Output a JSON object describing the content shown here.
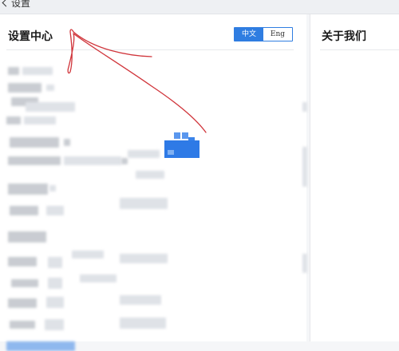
{
  "header": {
    "back_label": "设置"
  },
  "main": {
    "title": "设置中心"
  },
  "language": {
    "options": [
      "中文",
      "Eng"
    ],
    "selected": "中文"
  },
  "side": {
    "title": "关于我们"
  },
  "colors": {
    "accent": "#2f7de1",
    "annotation": "#d0343a"
  },
  "icons": {
    "back": "chevron-left-icon"
  }
}
